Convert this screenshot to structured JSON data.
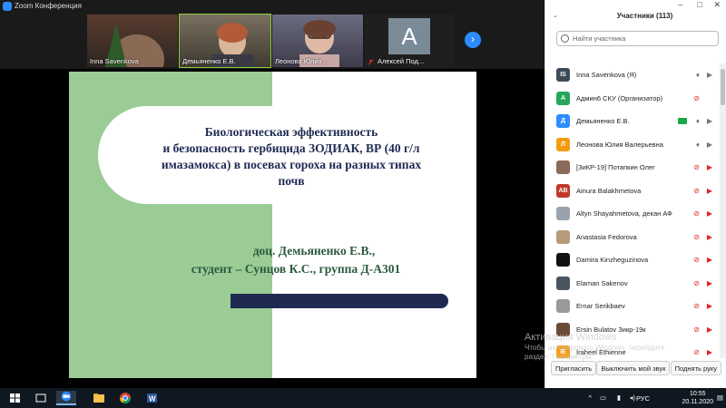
{
  "window": {
    "title": "Zoom Конференция"
  },
  "video_tiles": [
    {
      "name": "Inna Savenkova"
    },
    {
      "name": "Демьяненко Е.В."
    },
    {
      "name": "Леонова Юлия ..."
    },
    {
      "name": "Алексей Под...",
      "avatar_letter": "A"
    }
  ],
  "next_icon": "chevron-right-icon",
  "slide": {
    "title_lines": [
      "Биологическая эффективность",
      "и безопасность гербицида  ЗОДИАК, ВР  (40 г/л",
      "имазамокса) в посевах гороха на разных типах",
      "почв"
    ],
    "author_lines": [
      "доц. Демьяненко Е.В.,",
      "студент – Сунцов К.С., группа Д-А301"
    ]
  },
  "participants_panel": {
    "title": "Участники (113)",
    "search_placeholder": "Найти участника",
    "participants": [
      {
        "initials": "IS",
        "name": "Inna Savenkova (Я)",
        "color": "#3d4a5a"
      },
      {
        "initials": "А",
        "name": "Админ6 СКУ (Организатор)",
        "color": "#26a65b"
      },
      {
        "initials": "Д",
        "name": "Демьяненко Е.В.",
        "color": "#2d8cff"
      },
      {
        "initials": "Л",
        "name": "Леонова Юлия Валерьевна",
        "color": "#f39c12"
      },
      {
        "initials": "",
        "name": "[ЗиКР-19] Потапкин Олег",
        "color": "#8b6b5a"
      },
      {
        "initials": "AB",
        "name": "Ainura Balakhmetova",
        "color": "#c0392b"
      },
      {
        "initials": "",
        "name": "Altyn Shayahmetova, декан АФ",
        "color": "#9aa3ad"
      },
      {
        "initials": "",
        "name": "Anastasia Fedorova",
        "color": "#b89a7a"
      },
      {
        "initials": "",
        "name": "Damira Kinzheguzinova",
        "color": "#111111"
      },
      {
        "initials": "",
        "name": "Elaman Sakenov",
        "color": "#4a5560"
      },
      {
        "initials": "",
        "name": "Ernar Serikbaev",
        "color": "#9a9a9a"
      },
      {
        "initials": "",
        "name": "Ersin Bulatov Зикр-19к",
        "color": "#6b4a3a"
      },
      {
        "initials": "IE",
        "name": "Iraheel Ethienne",
        "color": "#f39c12"
      }
    ],
    "buttons": {
      "invite": "Пригласить",
      "mute_all": "Выключить мой звук",
      "raise_hand": "Поднять руку"
    }
  },
  "watermark": {
    "line1": "Активация Windows",
    "line2": "Чтобы активировать Windows, перейдите",
    "line3": "раздел \"Параметры\"."
  },
  "taskbar": {
    "lang": "РУС",
    "time": "10:55",
    "date": "20.11.2020"
  },
  "colors": {
    "zoom_blue": "#2d8cff",
    "slide_green": "#9ccc96",
    "slide_navy": "#1f2a52",
    "muted_red": "#e02828"
  }
}
